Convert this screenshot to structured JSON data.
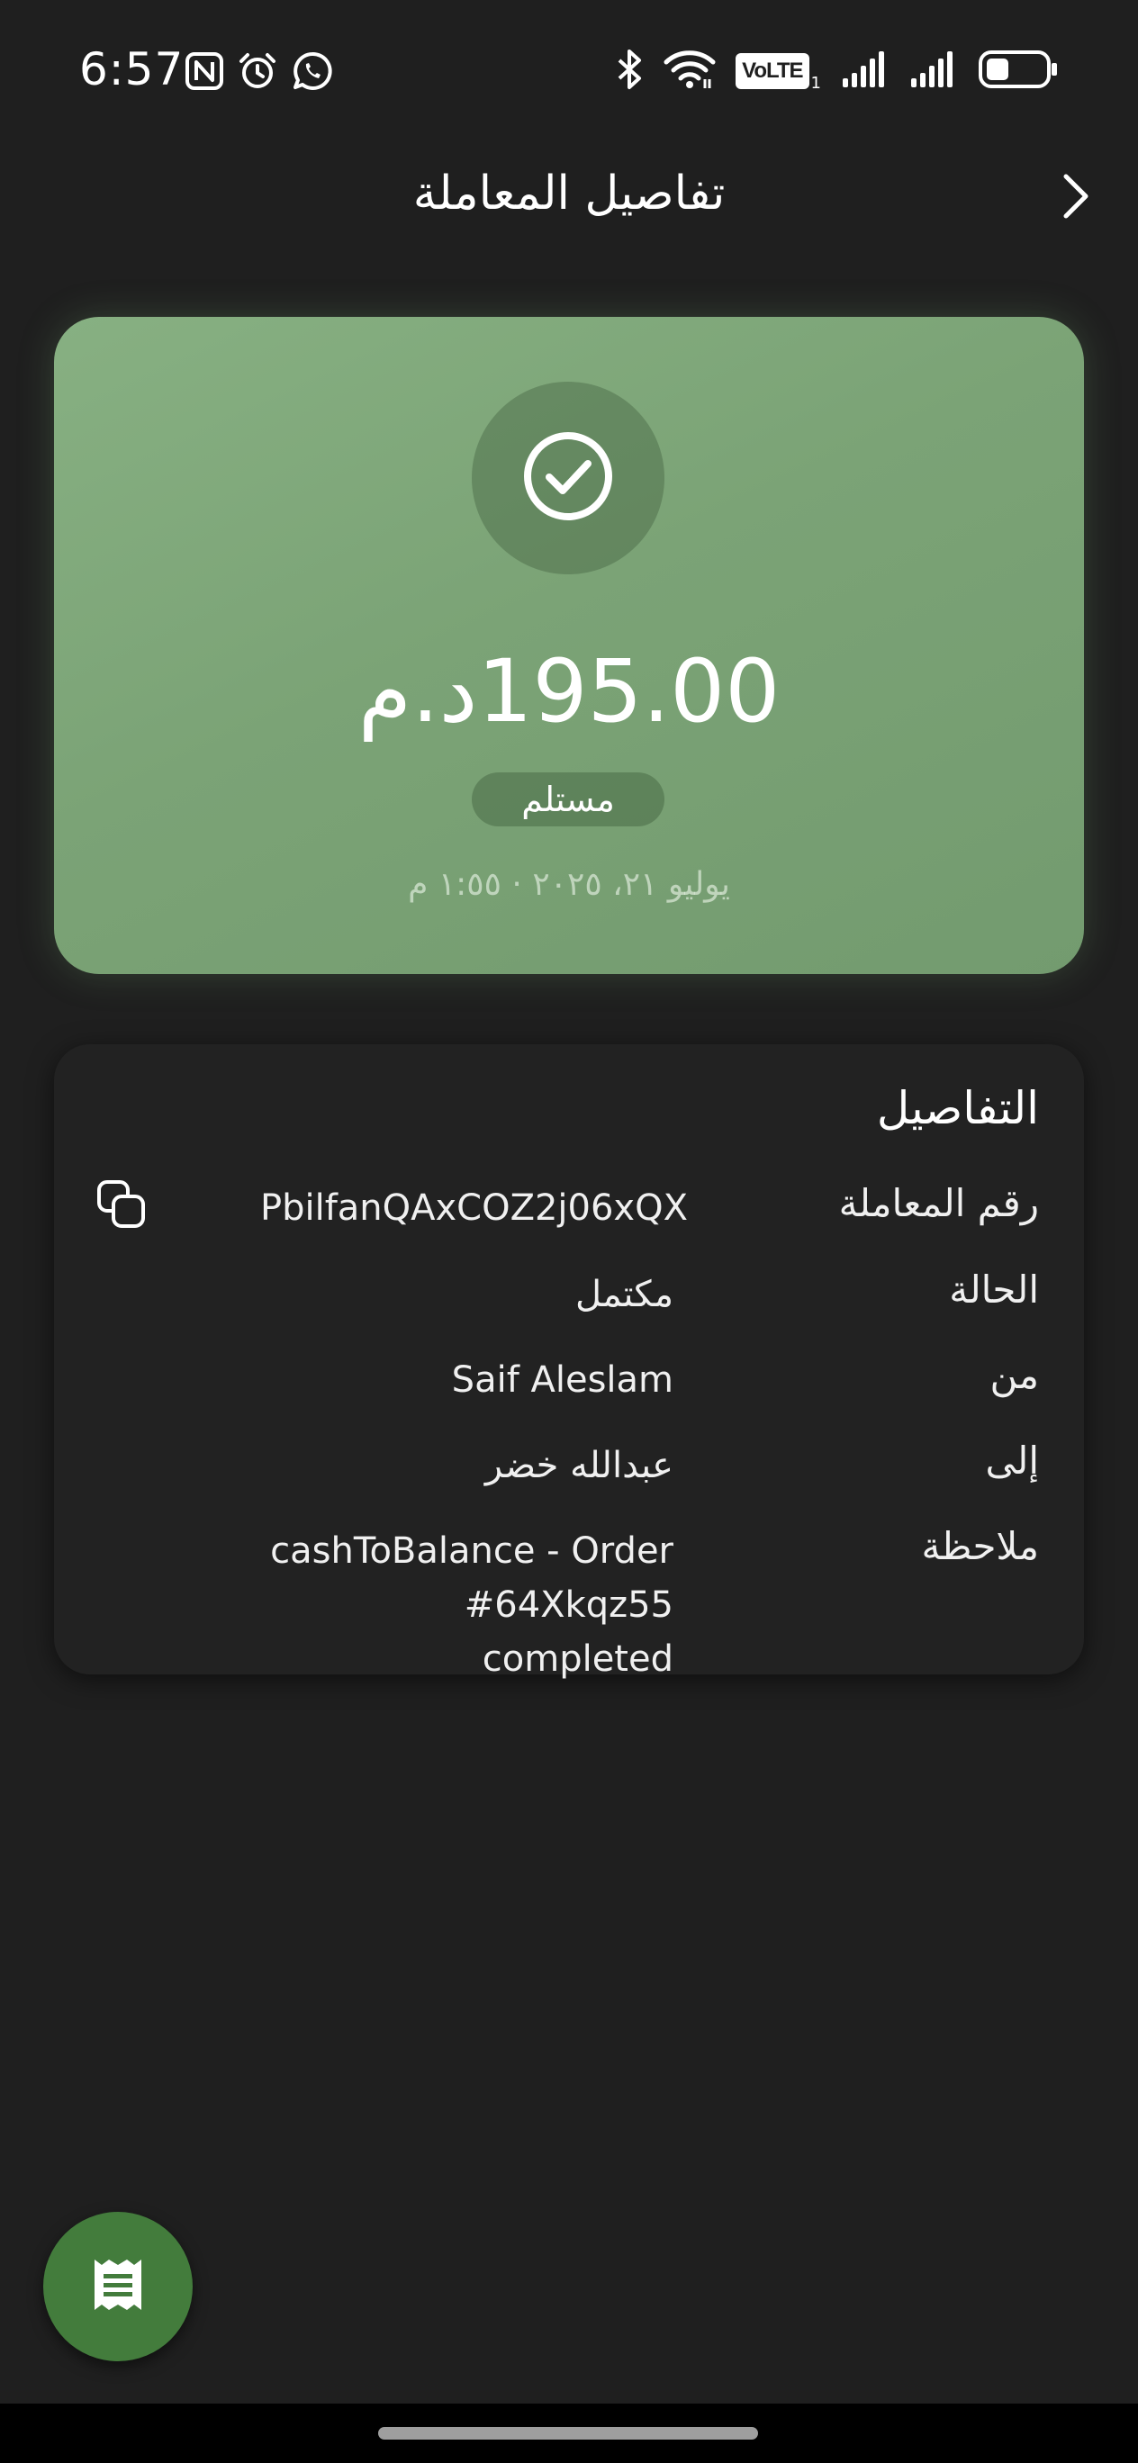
{
  "status_bar": {
    "time": "6:57",
    "volte_label": "VoLTE",
    "volte_sub": "1",
    "left_icons": [
      "nfc-icon",
      "alarm-icon",
      "whatsapp-icon"
    ],
    "right_icons": [
      "bluetooth-icon",
      "wifi-icon",
      "volte-icon",
      "signal-icon",
      "signal-icon",
      "battery-icon"
    ]
  },
  "header": {
    "title": "تفاصيل المعاملة",
    "back_icon": "chevron-right-icon"
  },
  "hero": {
    "icon": "check-circle-icon",
    "amount": "195.00د.م",
    "status": "مستلم",
    "datetime": "يوليو ٢١، ٢٠٢٥ · ١:٥٥ م",
    "colors": {
      "card": "#7ba376",
      "accent": "#437c3c"
    }
  },
  "details": {
    "heading": "التفاصيل",
    "rows": [
      {
        "label": "رقم المعاملة",
        "value": "PbilfanQAxCOZ2j06xQX"
      },
      {
        "label": "الحالة",
        "value": "مكتمل"
      },
      {
        "label": "من",
        "value": "Saif Aleslam"
      },
      {
        "label": "إلى",
        "value": "عبدالله خضر"
      },
      {
        "label": "ملاحظة",
        "value_line1": "cashToBalance - Order #64Xkqz55",
        "value_line2": "completed"
      }
    ],
    "copy_icon": "copy-icon"
  },
  "fab": {
    "icon": "receipt-icon"
  }
}
